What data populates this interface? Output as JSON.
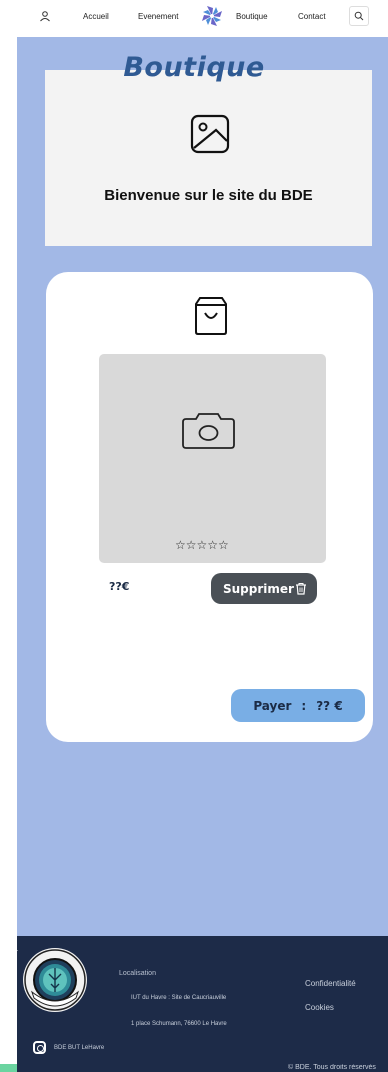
{
  "nav": {
    "links": [
      "Accueil",
      "Evenement",
      "Boutique",
      "Contact"
    ],
    "icons": {
      "user": "user-icon",
      "logo": "bde-logo",
      "search": "search-icon"
    }
  },
  "hero": {
    "title": "Boutique",
    "welcome": "Bienvenue sur le site du BDE"
  },
  "cart": {
    "rating": "☆☆☆☆☆",
    "price": "??€",
    "delete_label": "Supprimer",
    "pay_label": "Payer",
    "pay_separator": ":",
    "pay_total": "?? €"
  },
  "footer": {
    "localisation_label": "Localisation",
    "address_line1": "IUT du Havre : Site de Caucriauville",
    "address_line2": "1 place Schumann, 76600 Le Havre",
    "links": [
      "Confidentialité",
      "Cookies"
    ],
    "instagram": "BDE BUT LeHavre",
    "copyright": "© BDE. Tous droits réservés",
    "logo_text_top": "BDE INFORMATIQUE",
    "logo_text_bottom": "LE HAVRE"
  },
  "colors": {
    "main_bg": "#a2b8e6",
    "footer_bg": "#1d2b48",
    "title": "#2f5a93",
    "pay_button": "#79aee5",
    "delete_button": "#4a5056"
  }
}
